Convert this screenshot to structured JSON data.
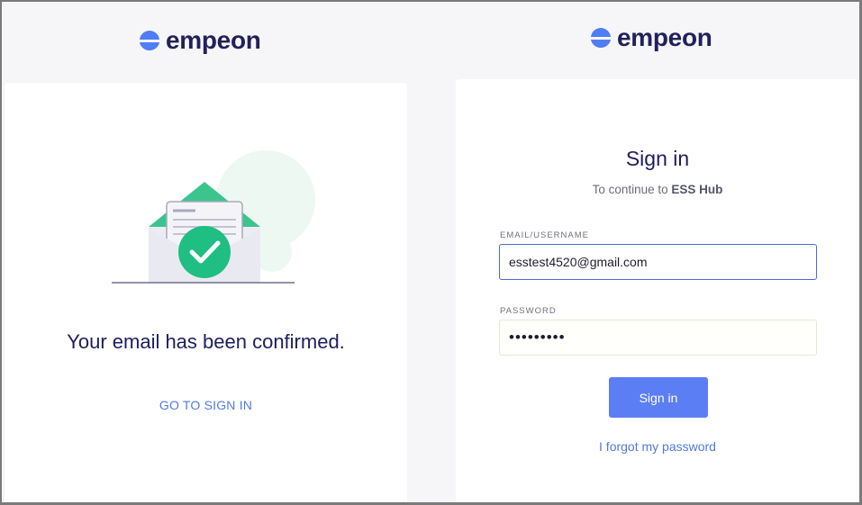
{
  "brand": {
    "name": "empeon",
    "icon": "empeon-logo-icon",
    "color": "#22215b",
    "accent": "#4f7df5"
  },
  "confirm_panel": {
    "illustration": "email-confirmed-envelope-icon",
    "message": "Your email has been confirmed.",
    "link_label": "GO TO SIGN IN"
  },
  "signin_panel": {
    "title": "Sign in",
    "subtitle_prefix": "To continue to",
    "subtitle_app": "ESS Hub",
    "email_label": "EMAIL/USERNAME",
    "email_value": "esstest4520@gmail.com",
    "password_label": "PASSWORD",
    "password_value": "•••••••••",
    "submit_label": "Sign in",
    "forgot_label": "I forgot my password"
  },
  "colors": {
    "button": "#5c7ef5",
    "link": "#4f7ae0",
    "check": "#1fbe83"
  }
}
